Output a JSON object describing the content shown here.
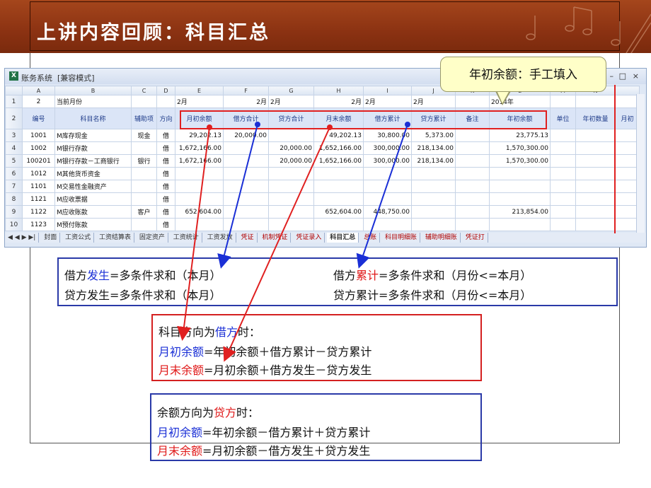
{
  "slide": {
    "title": "上讲内容回顾：科目汇总"
  },
  "window": {
    "app_title": "账务系统",
    "mode": "[兼容模式]",
    "minimize": "–",
    "restore": "□",
    "close": "×"
  },
  "columns": [
    "A",
    "B",
    "C",
    "D",
    "E",
    "F",
    "G",
    "H",
    "I",
    "J",
    "K",
    "L",
    "M",
    "N"
  ],
  "row1": {
    "num": "1",
    "a": "2",
    "b": "当前月份",
    "e": "2月",
    "f": "2月",
    "g": "2月",
    "h": "2月",
    "i": "2月",
    "j": "2月",
    "k": "2014年"
  },
  "header_row": {
    "num": "2",
    "a": "编号",
    "b": "科目名称",
    "c": "辅助项",
    "d": "方向",
    "e": "月初余额",
    "f": "借方合计",
    "g": "贷方合计",
    "h": "月末余额",
    "i": "借方累计",
    "j": "贷方累计",
    "k": "备注",
    "l": "年初余额",
    "m": "单位",
    "n": "年初数量",
    "o": "月初"
  },
  "rows": [
    {
      "num": "3",
      "a": "1001",
      "b": "M库存现金",
      "c": "现金",
      "d": "借",
      "e": "29,202.13",
      "f": "20,000.00",
      "g": "",
      "h": "49,202.13",
      "i": "30,800.00",
      "j": "5,373.00",
      "l": "23,775.13"
    },
    {
      "num": "4",
      "a": "1002",
      "b": "M银行存款",
      "c": "",
      "d": "借",
      "e": "1,672,166.00",
      "f": "",
      "g": "20,000.00",
      "h": "1,652,166.00",
      "i": "300,000.00",
      "j": "218,134.00",
      "l": "1,570,300.00"
    },
    {
      "num": "5",
      "a": "100201",
      "b": "M银行存款－工商银行",
      "c": "银行",
      "d": "借",
      "e": "1,672,166.00",
      "f": "",
      "g": "20,000.00",
      "h": "1,652,166.00",
      "i": "300,000.00",
      "j": "218,134.00",
      "l": "1,570,300.00"
    },
    {
      "num": "6",
      "a": "1012",
      "b": "M其他货币资金",
      "c": "",
      "d": "借",
      "e": "",
      "f": "",
      "g": "",
      "h": "",
      "i": "",
      "j": "",
      "l": ""
    },
    {
      "num": "7",
      "a": "1101",
      "b": "M交易性金融资产",
      "c": "",
      "d": "借",
      "e": "",
      "f": "",
      "g": "",
      "h": "",
      "i": "",
      "j": "",
      "l": ""
    },
    {
      "num": "8",
      "a": "1121",
      "b": "M应收票据",
      "c": "",
      "d": "借",
      "e": "",
      "f": "",
      "g": "",
      "h": "",
      "i": "",
      "j": "",
      "l": ""
    },
    {
      "num": "9",
      "a": "1122",
      "b": "M应收账款",
      "c": "客户",
      "d": "借",
      "e": "652,604.00",
      "f": "",
      "g": "",
      "h": "652,604.00",
      "i": "448,750.00",
      "j": "",
      "l": "213,854.00"
    },
    {
      "num": "10",
      "a": "1123",
      "b": "M预付账款",
      "c": "",
      "d": "借",
      "e": "",
      "f": "",
      "g": "",
      "h": "",
      "i": "",
      "j": "",
      "l": ""
    }
  ],
  "sheet_tabs": [
    "封面",
    "工资公式",
    "工资结算表",
    "固定资产",
    "工资统计",
    "工资发放",
    "凭证",
    "机制凭证",
    "凭证录入",
    "科目汇总",
    "总账",
    "科目明细账",
    "辅助明细账",
    "凭证打"
  ],
  "active_tab": "科目汇总",
  "callout": "年初余额：手工填入",
  "box1": {
    "l1_a": "借方",
    "l1_b": "发生",
    "l1_c": "=多条件求和（本月）",
    "l1_d": "借方",
    "l1_e": "累计",
    "l1_f": "=多条件求和（月份<=本月）",
    "l2_a": "贷方发生=多条件求和（本月）",
    "l2_b": "贷方累计=多条件求和（月份<=本月）"
  },
  "box2": {
    "l1_a": "科目方向为",
    "l1_b": "借方",
    "l1_c": "时：",
    "l2_a": "月初余额",
    "l2_b": "=年初余额＋借方累计－贷方累计",
    "l3_a": "月末余额",
    "l3_b": "=月初余额＋借方发生－贷方发生"
  },
  "box3": {
    "l1_a": "余额方向为",
    "l1_b": "贷方",
    "l1_c": "时：",
    "l2_a": "月初余额",
    "l2_b": "=年初余额－借方累计＋贷方累计",
    "l3_a": "月末余额",
    "l3_b": "=月初余额－借方发生＋贷方发生"
  },
  "colors": {
    "banner": "#8b3212",
    "red": "#e01818",
    "blue": "#1a2fd6",
    "callout_bg": "#ffffc8"
  }
}
